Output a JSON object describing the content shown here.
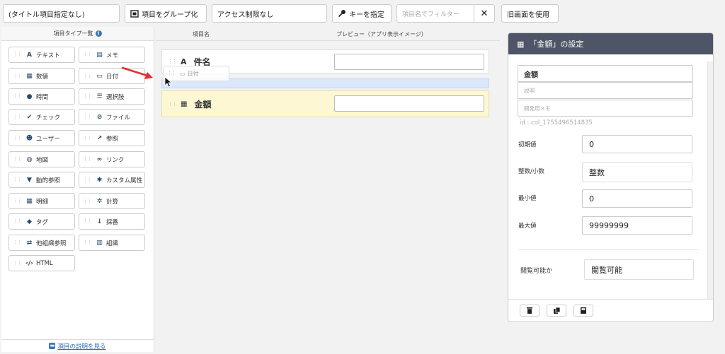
{
  "toolbar": {
    "title_field": "(タイトル項目指定なし)",
    "group": "項目をグループ化",
    "access": "アクセス制限なし",
    "key": "キーを指定",
    "filter_placeholder": "項目名でフィルター",
    "close": "✕",
    "old": "旧画面を使用"
  },
  "left": {
    "header": "項目タイプ一覧",
    "types": [
      "テキスト",
      "メモ",
      "数値",
      "日付",
      "時間",
      "選択肢",
      "チェック",
      "ファイル",
      "ユーザー",
      "参照",
      "地図",
      "リンク",
      "動的参照",
      "カスタム属性",
      "明細",
      "計算",
      "タグ",
      "採番",
      "他組織参照",
      "組織",
      "HTML"
    ],
    "help_link": "項目の説明を見る"
  },
  "middle": {
    "col1": "項目名",
    "col2": "プレビュー（アプリ表示イメージ）",
    "fields": [
      {
        "name": "件名",
        "icon": "A"
      },
      {
        "name": "金額",
        "icon": "▦"
      }
    ],
    "drag_ghost": "日付"
  },
  "right": {
    "title": "「金額」の設定",
    "name_value": "金額",
    "desc_placeholder": "説明",
    "memo_placeholder": "開発用メモ",
    "id_text": "id : col_1755496514835",
    "rows": [
      {
        "label": "初期値",
        "value": "0"
      },
      {
        "label": "整数/小数",
        "value": "整数"
      },
      {
        "label": "最小値",
        "value": "0"
      },
      {
        "label": "最大値",
        "value": "99999999"
      },
      {
        "label": "閲覧可能か",
        "value": "閲覧可能"
      }
    ]
  },
  "colors": {
    "accent": "#3a78b5",
    "header": "#4d5566",
    "drop_zone": "#dbe7fb",
    "selected_row": "#fdf7d3",
    "arrow": "#e03030"
  }
}
